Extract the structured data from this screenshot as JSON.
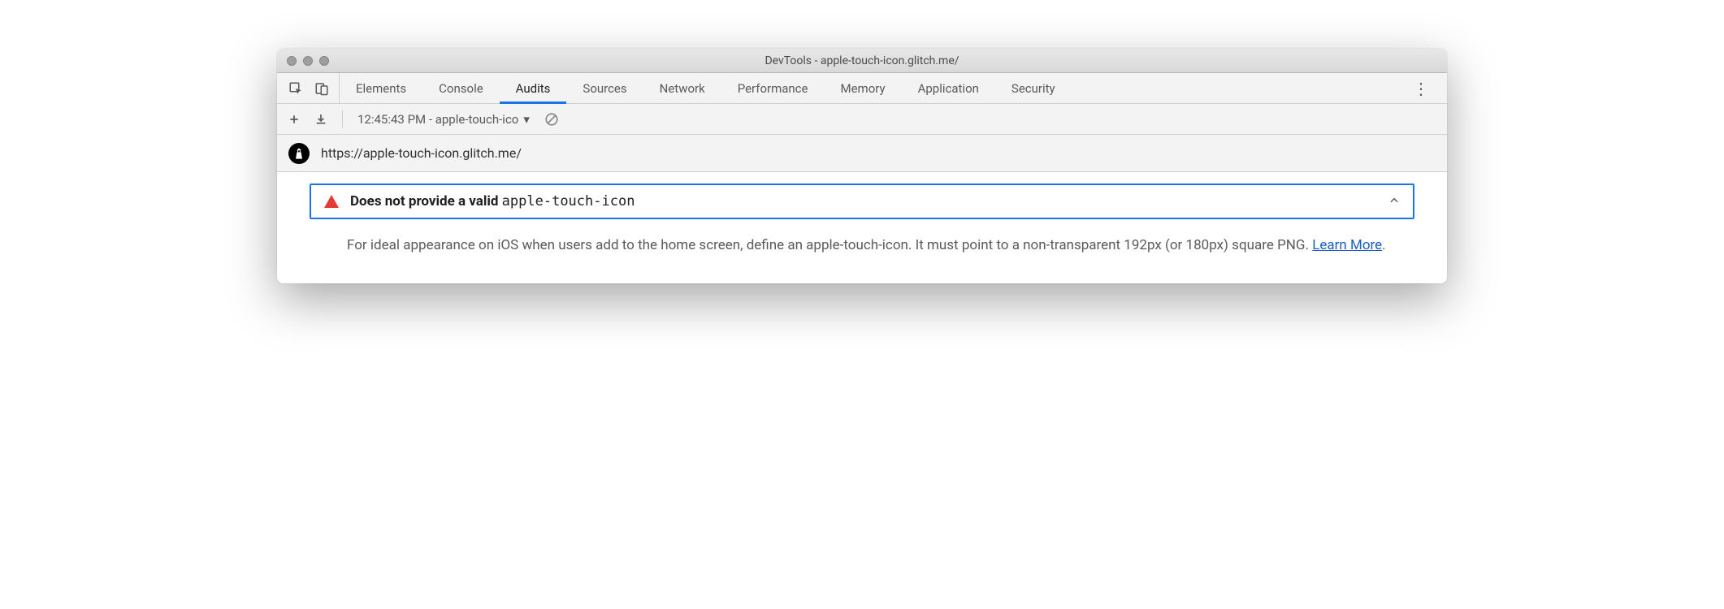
{
  "window": {
    "title": "DevTools - apple-touch-icon.glitch.me/"
  },
  "tabs": [
    {
      "label": "Elements",
      "active": false
    },
    {
      "label": "Console",
      "active": false
    },
    {
      "label": "Audits",
      "active": true
    },
    {
      "label": "Sources",
      "active": false
    },
    {
      "label": "Network",
      "active": false
    },
    {
      "label": "Performance",
      "active": false
    },
    {
      "label": "Memory",
      "active": false
    },
    {
      "label": "Application",
      "active": false
    },
    {
      "label": "Security",
      "active": false
    }
  ],
  "toolbar": {
    "run_label": "12:45:43 PM - apple-touch-ico"
  },
  "page": {
    "url": "https://apple-touch-icon.glitch.me/"
  },
  "audit": {
    "title_prefix": "Does not provide a valid ",
    "title_code": "apple-touch-icon",
    "description_before_link": "For ideal appearance on iOS when users add to the home screen, define an apple-touch-icon. It must point to a non-transparent 192px (or 180px) square PNG. ",
    "learn_more": "Learn More",
    "description_after_link": "."
  }
}
